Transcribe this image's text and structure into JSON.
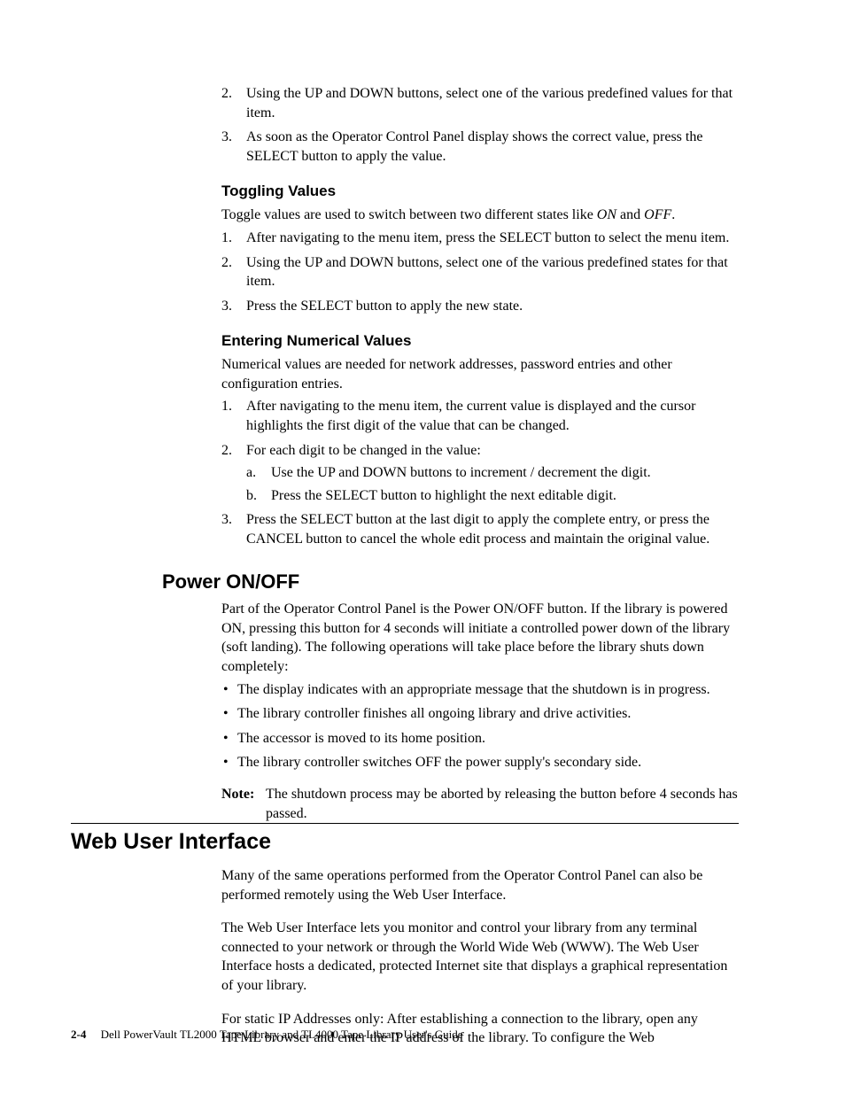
{
  "top_list": {
    "item2": {
      "marker": "2.",
      "text": "Using the UP and DOWN buttons, select one of the various predefined values for that item."
    },
    "item3": {
      "marker": "3.",
      "text": "As soon as the Operator Control Panel display shows the correct value, press the SELECT button to apply the value."
    }
  },
  "toggling": {
    "heading": "Toggling Values",
    "intro_pre": "Toggle values are used to switch between two different states like ",
    "on": "ON",
    "and": " and ",
    "off": "OFF",
    "period": ".",
    "items": {
      "i1": {
        "marker": "1.",
        "text": "After navigating to the menu item, press the SELECT button to select the menu item."
      },
      "i2": {
        "marker": "2.",
        "text": "Using the UP and DOWN buttons, select one of the various predefined states for that item."
      },
      "i3": {
        "marker": "3.",
        "text": "Press the SELECT button to apply the new state."
      }
    }
  },
  "entering": {
    "heading": "Entering Numerical Values",
    "intro": "Numerical values are needed for network addresses, password entries and other configuration entries.",
    "items": {
      "i1": {
        "marker": "1.",
        "text": "After navigating to the menu item, the current value is displayed and the cursor highlights the first digit of the value that can be changed."
      },
      "i2": {
        "marker": "2.",
        "text": "For each digit to be changed in the value:",
        "sub": {
          "a": {
            "marker": "a.",
            "text": "Use the UP and DOWN buttons to increment / decrement the digit."
          },
          "b": {
            "marker": "b.",
            "text": "Press the SELECT button to highlight the next editable digit."
          }
        }
      },
      "i3": {
        "marker": "3.",
        "text": "Press the SELECT button at the last digit to apply the complete entry, or press the CANCEL button to cancel the whole edit process and maintain the original value."
      }
    }
  },
  "power": {
    "heading": "Power ON/OFF",
    "intro": "Part of the Operator Control Panel is the Power ON/OFF button. If the library is powered ON, pressing this button for 4 seconds will initiate a controlled power down of the library (soft landing). The following operations will take place before the library shuts down completely:",
    "bullets": {
      "b1": "The display indicates with an appropriate message that the shutdown is in progress.",
      "b2": "The library controller finishes all ongoing library and drive activities.",
      "b3": "The accessor is moved to its home position.",
      "b4": "The library controller switches OFF the power supply's secondary side."
    },
    "note_label": "Note:",
    "note_text": "The shutdown process may be aborted by releasing the button before 4 seconds has passed."
  },
  "web": {
    "heading": "Web User Interface",
    "p1": "Many of the same operations performed from the Operator Control Panel can also be performed remotely using the Web User Interface.",
    "p2": "The Web User Interface lets you monitor and control your library from any terminal connected to your network or through the World Wide Web (WWW). The Web User Interface hosts a dedicated, protected Internet site that displays a graphical representation of your library.",
    "p3": "For static IP Addresses only: After establishing a connection to the library, open any HTML browser and enter the IP address of the library. To configure the Web"
  },
  "footer": {
    "page": "2-4",
    "title": "Dell PowerVault TL2000 Tape Library and TL4000 Tape Library User's Guide"
  }
}
